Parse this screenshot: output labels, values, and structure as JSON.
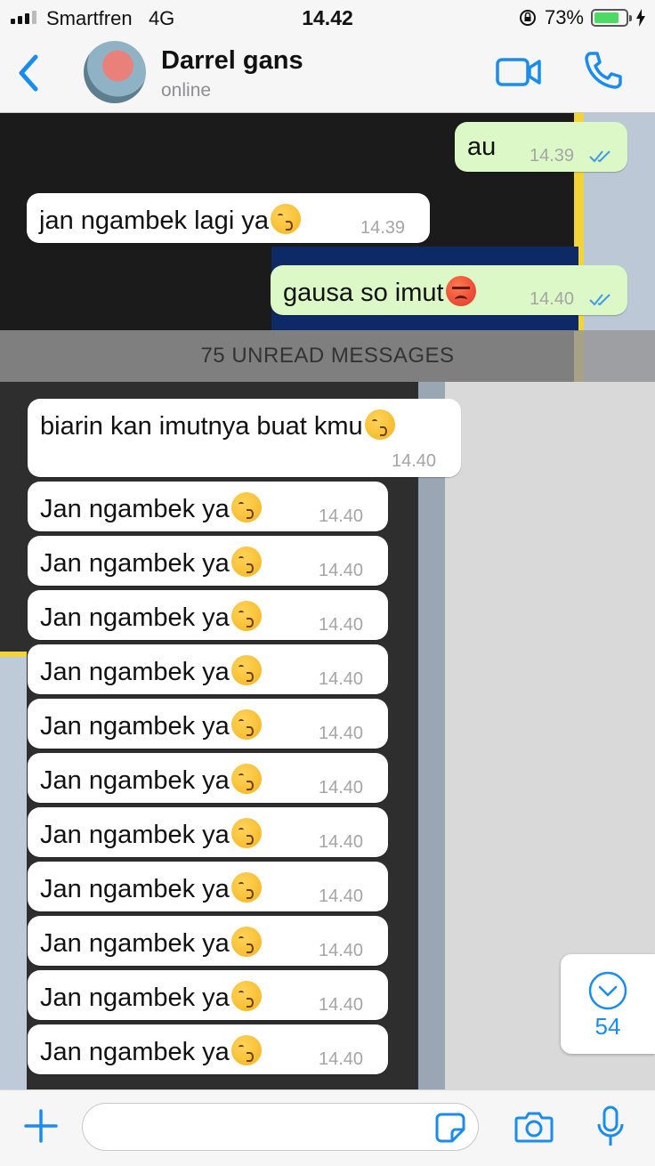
{
  "status_bar": {
    "carrier": "Smartfren",
    "network": "4G",
    "time": "14.42",
    "battery": "73%"
  },
  "header": {
    "contact_name": "Darrel gans",
    "contact_status": "online"
  },
  "messages_top": [
    {
      "dir": "out",
      "text": "au",
      "time": "14.39",
      "emoji": null
    },
    {
      "dir": "in",
      "text": "jan ngambek lagi ya",
      "time": "14.39",
      "emoji": "kissing-face"
    },
    {
      "dir": "out",
      "text": "gausa so imut",
      "time": "14.40",
      "emoji": "angry-face"
    }
  ],
  "unread_banner": "75 UNREAD MESSAGES",
  "messages_bottom": [
    {
      "dir": "in",
      "text": "biarin kan imutnya buat kmu",
      "time": "14.40",
      "emoji": "kissing-face"
    },
    {
      "dir": "in",
      "text": "Jan ngambek ya",
      "time": "14.40",
      "emoji": "kissing-face"
    },
    {
      "dir": "in",
      "text": "Jan ngambek ya",
      "time": "14.40",
      "emoji": "kissing-face"
    },
    {
      "dir": "in",
      "text": "Jan ngambek ya",
      "time": "14.40",
      "emoji": "kissing-face"
    },
    {
      "dir": "in",
      "text": "Jan ngambek ya",
      "time": "14.40",
      "emoji": "kissing-face"
    },
    {
      "dir": "in",
      "text": "Jan ngambek ya",
      "time": "14.40",
      "emoji": "kissing-face"
    },
    {
      "dir": "in",
      "text": "Jan ngambek ya",
      "time": "14.40",
      "emoji": "kissing-face"
    },
    {
      "dir": "in",
      "text": "Jan ngambek ya",
      "time": "14.40",
      "emoji": "kissing-face"
    },
    {
      "dir": "in",
      "text": "Jan ngambek ya",
      "time": "14.40",
      "emoji": "kissing-face"
    },
    {
      "dir": "in",
      "text": "Jan ngambek ya",
      "time": "14.40",
      "emoji": "kissing-face"
    },
    {
      "dir": "in",
      "text": "Jan ngambek ya",
      "time": "14.40",
      "emoji": "kissing-face"
    },
    {
      "dir": "in",
      "text": "Jan ngambek ya",
      "time": "14.40",
      "emoji": "kissing-face"
    }
  ],
  "scroll_button": {
    "unread_count": "54"
  },
  "colors": {
    "accent": "#1a8cf0",
    "outgoing_bubble": "#dcf8c6",
    "incoming_bubble": "#ffffff",
    "read_ticks": "#3f9be8"
  }
}
